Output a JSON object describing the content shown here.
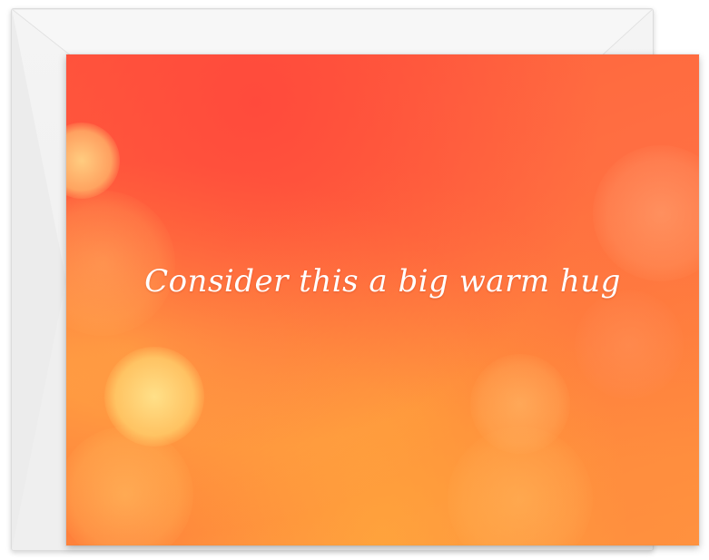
{
  "card": {
    "message": "Consider this a big warm hug",
    "text_color": "#ffffff",
    "palette": {
      "red": "#ff5a3c",
      "orange": "#ff7f3a",
      "glow": "#ffd87a"
    }
  },
  "envelope": {
    "color": "#f2f2f2"
  }
}
